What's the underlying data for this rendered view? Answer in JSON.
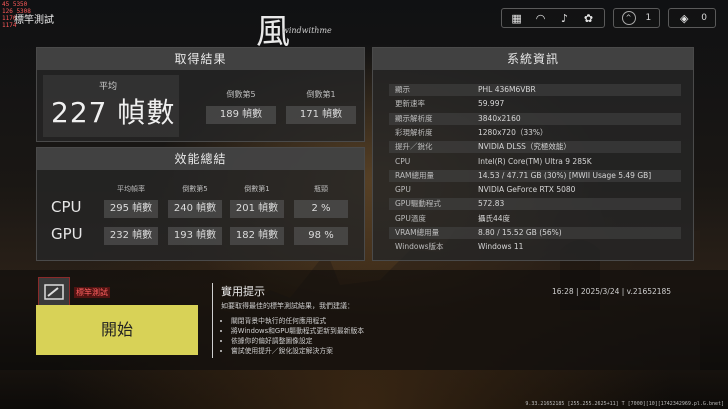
{
  "overlay": {
    "lines": [
      "45  5350",
      "126 5308",
      "1170",
      "1174"
    ],
    "title": "標竿測試"
  },
  "logo": {
    "char": "風",
    "text": "windwithme"
  },
  "topbar": {
    "icons": [
      "grid-icon",
      "headset-icon",
      "bell-icon",
      "gear-icon"
    ],
    "level_value": "1",
    "points_value": "0"
  },
  "results": {
    "heading": "取得結果",
    "avg_label": "平均",
    "avg_value": "227 幀數",
    "low5_label": "倒數第5",
    "low5_value": "189 幀數",
    "low1_label": "倒數第1",
    "low1_value": "171 幀數"
  },
  "perf": {
    "heading": "效能總結",
    "columns": [
      "平均幀率",
      "倒數第5",
      "倒數第1",
      "瓶頸"
    ],
    "rows": [
      {
        "label": "CPU",
        "avg": "295 幀數",
        "low5": "240 幀數",
        "low1": "201 幀數",
        "bottleneck": "2 %"
      },
      {
        "label": "GPU",
        "avg": "232 幀數",
        "low5": "193 幀數",
        "low1": "182 幀數",
        "bottleneck": "98 %"
      }
    ]
  },
  "sysinfo": {
    "heading": "系統資訊",
    "rows": [
      {
        "k": "顯示",
        "v": "PHL 436M6VBR"
      },
      {
        "k": "更新速率",
        "v": "59.997"
      },
      {
        "k": "顯示解析度",
        "v": "3840x2160"
      },
      {
        "k": "彩現解析度",
        "v": "1280x720（33%）"
      },
      {
        "k": "提升／銳化",
        "v": "NVIDIA DLSS（究極效能）"
      },
      {
        "k": "CPU",
        "v": "Intel(R) Core(TM) Ultra 9 285K"
      },
      {
        "k": "RAM總用量",
        "v": "14.53 / 47.71 GB (30%) [MWII Usage 5.49 GB]"
      },
      {
        "k": "GPU",
        "v": "NVIDIA GeForce RTX 5080"
      },
      {
        "k": "GPU驅動程式",
        "v": "572.83"
      },
      {
        "k": "GPU溫度",
        "v": "攝氏44度"
      },
      {
        "k": "VRAM總用量",
        "v": "8.80 / 15.52 GB (56%)"
      },
      {
        "k": "Windows版本",
        "v": "Windows 11"
      }
    ]
  },
  "bench": {
    "tag": "標竿測試",
    "start_label": "開始"
  },
  "tips": {
    "title": "實用提示",
    "subtitle": "如要取得最佳的標竿測試結果，我們建議：",
    "items": [
      "關閉背景中執行的任何應用程式",
      "將Windows和GPU驅動程式更新到最新版本",
      "依據你的偏好調整圖像設定",
      "嘗試使用提升／銳化設定解決方案"
    ]
  },
  "datetime": "16:28 | 2025/3/24 | v.21652185",
  "footer_id": "9.33.21652185 [255.255.2625+11] T [7000][10][1742342969.pl.G.bnet]"
}
